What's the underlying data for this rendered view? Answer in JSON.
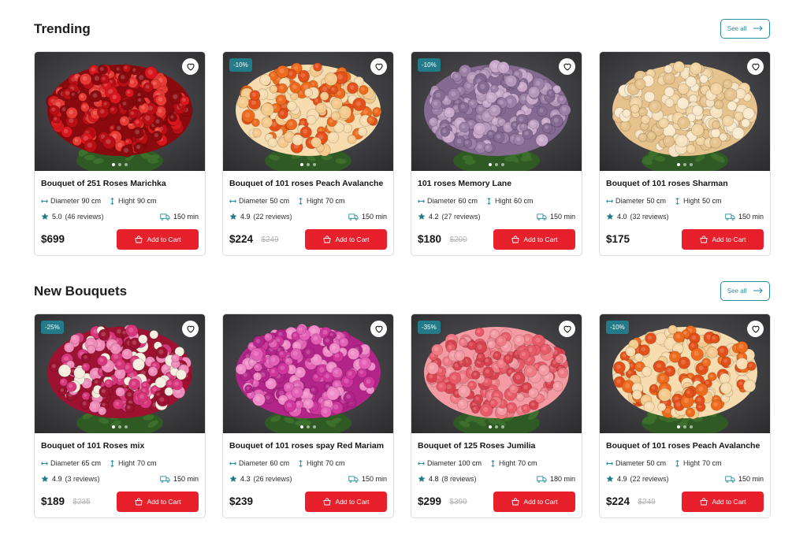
{
  "sections": [
    {
      "title": "Trending",
      "see_all": "See all",
      "products": [
        {
          "name": "Bouquet of 251 Roses Marichka",
          "badge": "",
          "diameter_label": "Diameter",
          "diameter": "90 cm",
          "height_label": "Hight",
          "height": "90 cm",
          "rating": "5.0",
          "reviews": "(46 reviews)",
          "delivery": "150 min",
          "price": "$699",
          "old_price": "",
          "cart_label": "Add to Cart",
          "palette": [
            "#b80e14",
            "#d8161d",
            "#8a0a0e",
            "#e83a34"
          ]
        },
        {
          "name": "Bouquet of 101 roses Peach Avalanche",
          "badge": "-10%",
          "diameter_label": "Diameter",
          "diameter": "50 cm",
          "height_label": "Hight",
          "height": "70 cm",
          "rating": "4.9",
          "reviews": "(22 reviews)",
          "delivery": "150 min",
          "price": "$224",
          "old_price": "$249",
          "cart_label": "Add to Cart",
          "palette": [
            "#f4c98c",
            "#ee6a1c",
            "#f7dcb0",
            "#e4501a"
          ]
        },
        {
          "name": "101 roses Memory Lane",
          "badge": "-10%",
          "diameter_label": "Diameter",
          "diameter": "60 cm",
          "height_label": "Hight",
          "height": "60 cm",
          "rating": "4.2",
          "reviews": "(27 reviews)",
          "delivery": "150 min",
          "price": "$180",
          "old_price": "$200",
          "cart_label": "Add to Cart",
          "palette": [
            "#9c7fa6",
            "#b497ba",
            "#856a92",
            "#c8a9cc"
          ]
        },
        {
          "name": "Bouquet of 101 roses Sharman",
          "badge": "",
          "diameter_label": "Diameter",
          "diameter": "50 cm",
          "height_label": "Hight",
          "height": "50 cm",
          "rating": "4.0",
          "reviews": "(32 reviews)",
          "delivery": "150 min",
          "price": "$175",
          "old_price": "",
          "cart_label": "Add to Cart",
          "palette": [
            "#f2d3a2",
            "#f7e2bf",
            "#e6c28c",
            "#fae9cc"
          ]
        }
      ]
    },
    {
      "title": "New Bouquets",
      "see_all": "See all",
      "products": [
        {
          "name": "Bouquet of 101 Roses mix",
          "badge": "-25%",
          "diameter_label": "Diameter",
          "diameter": "65 cm",
          "height_label": "Hight",
          "height": "70 cm",
          "rating": "4.9",
          "reviews": "(3 reviews)",
          "delivery": "150 min",
          "price": "$189",
          "old_price": "$235",
          "cart_label": "Add to Cart",
          "palette": [
            "#f3eedf",
            "#d8367a",
            "#9c1230",
            "#f08ab8"
          ]
        },
        {
          "name": "Bouquet of 101 roses spay Red Mariam",
          "badge": "",
          "diameter_label": "Diameter",
          "diameter": "60 cm",
          "height_label": "Hight",
          "height": "70 cm",
          "rating": "4.3",
          "reviews": "(26 reviews)",
          "delivery": "150 min",
          "price": "$239",
          "old_price": "",
          "cart_label": "Add to Cart",
          "palette": [
            "#d0359c",
            "#e45fb6",
            "#b22488",
            "#f08ac9"
          ]
        },
        {
          "name": "Bouquet of 125 Roses Jumilia",
          "badge": "-35%",
          "diameter_label": "Diameter",
          "diameter": "100 cm",
          "height_label": "Hight",
          "height": "70 cm",
          "rating": "4.8",
          "reviews": "(8 reviews)",
          "delivery": "180 min",
          "price": "$299",
          "old_price": "$399",
          "cart_label": "Add to Cart",
          "palette": [
            "#f07a84",
            "#e85a68",
            "#f49aa2",
            "#d9424f"
          ]
        },
        {
          "name": "Bouquet of 101 roses Peach Avalanche",
          "badge": "-10%",
          "diameter_label": "Diameter",
          "diameter": "50 cm",
          "height_label": "Hight",
          "height": "70 cm",
          "rating": "4.9",
          "reviews": "(22 reviews)",
          "delivery": "150 min",
          "price": "$224",
          "old_price": "$249",
          "cart_label": "Add to Cart",
          "palette": [
            "#f4c98c",
            "#ee6a1c",
            "#f7dcb0",
            "#e4501a"
          ]
        }
      ]
    }
  ],
  "colors": {
    "accent": "#e8202c",
    "teal": "#237a89",
    "star": "#237a89"
  },
  "icons": [
    "heart-icon",
    "width-arrows-icon",
    "height-arrows-icon",
    "star-icon",
    "truck-icon",
    "cart-icon",
    "arrow-right-icon"
  ]
}
